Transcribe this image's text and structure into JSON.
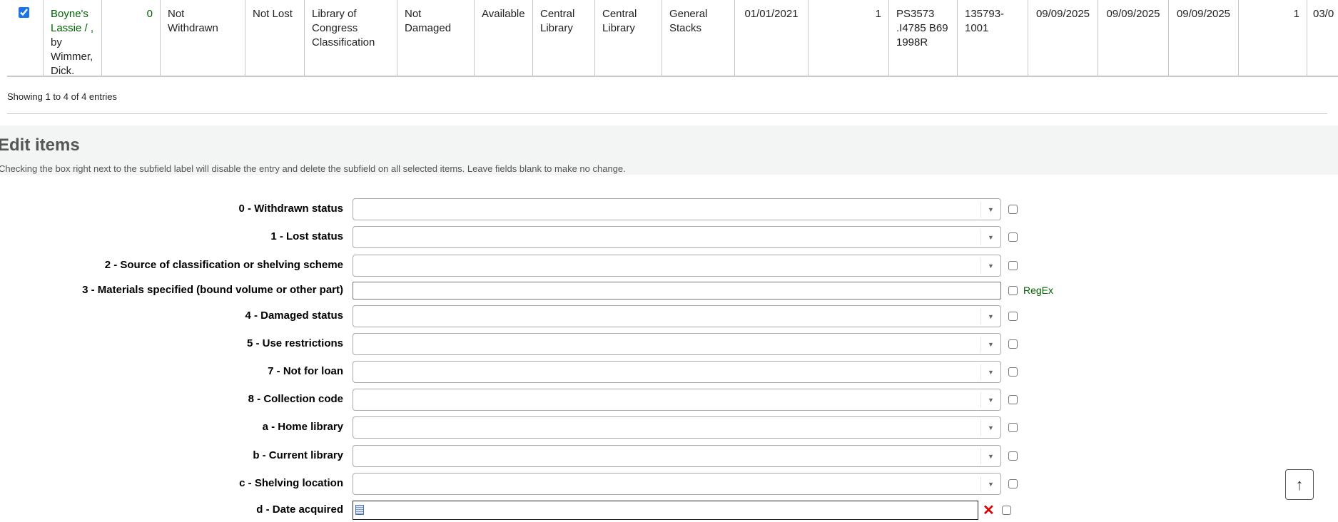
{
  "table": {
    "row": {
      "selected": true,
      "title": "Boyne's Lassie / ,",
      "author": "by Wimmer, Dick.",
      "cells": [
        "0",
        "Not Withdrawn",
        "Not Lost",
        "Library of Congress Classification",
        "Not Damaged",
        "Available",
        "Central Library",
        "Central Library",
        "General Stacks",
        "01/01/2021",
        "1",
        "PS3573 .I4785 B69 1998R",
        "135793-1001",
        "09/09/2025",
        "09/09/2025",
        "09/09/2025",
        "1",
        "03/0"
      ]
    },
    "info": "Showing 1 to 4 of 4 entries"
  },
  "edit": {
    "title": "Edit items",
    "description": "Checking the box right next to the subfield label will disable the entry and delete the subfield on all selected items. Leave fields blank to make no change.",
    "fields": [
      {
        "label": "0 - Withdrawn status"
      },
      {
        "label": "1 - Lost status"
      },
      {
        "label": "2 - Source of classification or shelving scheme"
      },
      {
        "label": "3 - Materials specified (bound volume or other part)",
        "regex": "RegEx"
      },
      {
        "label": "4 - Damaged status"
      },
      {
        "label": "5 - Use restrictions"
      },
      {
        "label": "7 - Not for loan"
      },
      {
        "label": "8 - Collection code"
      },
      {
        "label": "a - Home library"
      },
      {
        "label": "b - Current library"
      },
      {
        "label": "c - Shelving location"
      },
      {
        "label": "d - Date acquired"
      }
    ]
  },
  "back_to_top": "↑"
}
